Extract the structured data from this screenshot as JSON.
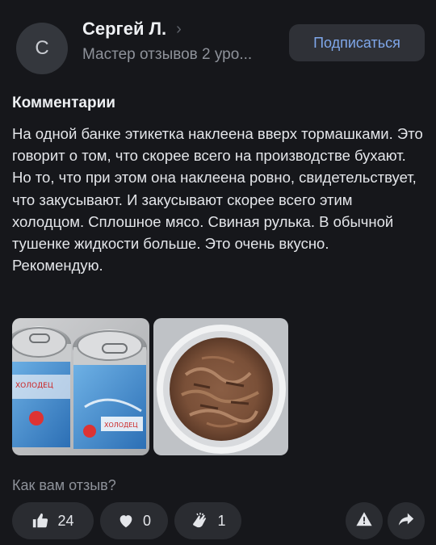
{
  "author": {
    "avatar_letter": "С",
    "name": "Сергей Л.",
    "subtitle": "Мастер отзывов 2 уро..."
  },
  "subscribe_label": "Подписаться",
  "section_title": "Комментарии",
  "comment": "На одной банке этикетка наклеена вверх тормашками. Это говорит о том, что скорее всего на производстве бухают. Но то, что при этом она наклеена ровно, свидетельствует, что закусывают. И закусывают скорее всего этим холодцом. Сплошное мясо. Свиная рулька. В обычной тушенке жидкости больше. Это очень вкусно. Рекомендую.",
  "question": "Как вам отзыв?",
  "reactions": {
    "like_count": "24",
    "heart_count": "0",
    "clap_count": "1"
  },
  "colors": {
    "background": "#16171b",
    "surface": "#2a2c31",
    "accent": "#7fa7ea",
    "muted": "#8e929a"
  },
  "icons": [
    "chevron-right-icon",
    "thumbs-up-icon",
    "heart-icon",
    "clap-icon",
    "alert-icon",
    "share-icon"
  ]
}
